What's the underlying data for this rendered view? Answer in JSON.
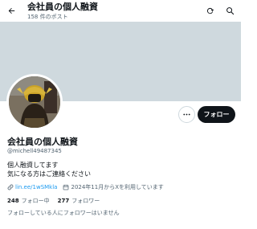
{
  "header": {
    "title": "会社員の個人融資",
    "post_count": "158",
    "post_label": "件のポスト",
    "back_icon": "back-arrow-icon",
    "actions": [
      "refresh-icon",
      "search-icon"
    ]
  },
  "profile": {
    "name": "会社員の個人融資",
    "handle": "@michell49487345",
    "bio": [
      "個人融資してます",
      "気になる方はご連絡ください"
    ],
    "link": "lin.ee/1wSMkla",
    "joined": "2024年11月からXを利用しています",
    "following_count": "248",
    "following_label": "フォロー中",
    "followers_count": "277",
    "followers_label": "フォロワー",
    "followed_by_note": "フォローしている人にフォロワーはいません"
  },
  "buttons": {
    "follow": "フォロー",
    "more": "more-icon"
  },
  "colors": {
    "banner": "#cfd9de",
    "link": "#1d9bf0",
    "follow_bg": "#0f1419",
    "secondary_text": "#536471"
  }
}
